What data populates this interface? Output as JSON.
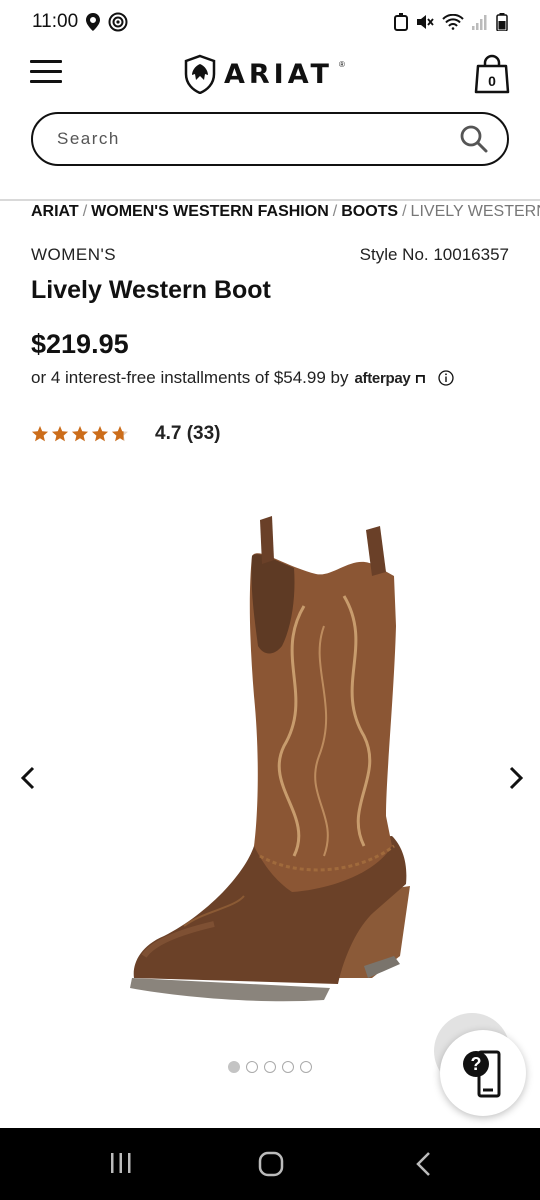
{
  "status_bar": {
    "time": "11:00",
    "icons": [
      "location-icon",
      "data-saver-icon",
      "nfc-icon",
      "mute-icon",
      "wifi-icon",
      "signal-icon",
      "battery-icon"
    ]
  },
  "header": {
    "logo_text": "ARIAT",
    "logo_mark": "®",
    "cart_count": "0"
  },
  "search": {
    "placeholder": "Search"
  },
  "breadcrumb": {
    "items": [
      "ARIAT",
      "WOMEN'S WESTERN FASHION",
      "BOOTS",
      "LIVELY WESTERN BOOT"
    ],
    "separator": "/"
  },
  "product": {
    "gender": "WOMEN'S",
    "style_no": "Style No. 10016357",
    "title": "Lively Western Boot",
    "price": "$219.95",
    "installment_text": "or 4 interest-free installments of $54.99 by",
    "afterpay_label": "afterpay",
    "rating_value": "4.7",
    "review_count": "(33)",
    "rating_text": "4.7 (33)",
    "stars": 4.7,
    "star_color": "#cc6d1a"
  },
  "gallery": {
    "image_name": "boot-image",
    "total_images": 5,
    "active_index": 0
  },
  "colors": {
    "text": "#111111",
    "boot_brown": "#6b4128",
    "boot_tan": "#a06a3c"
  }
}
